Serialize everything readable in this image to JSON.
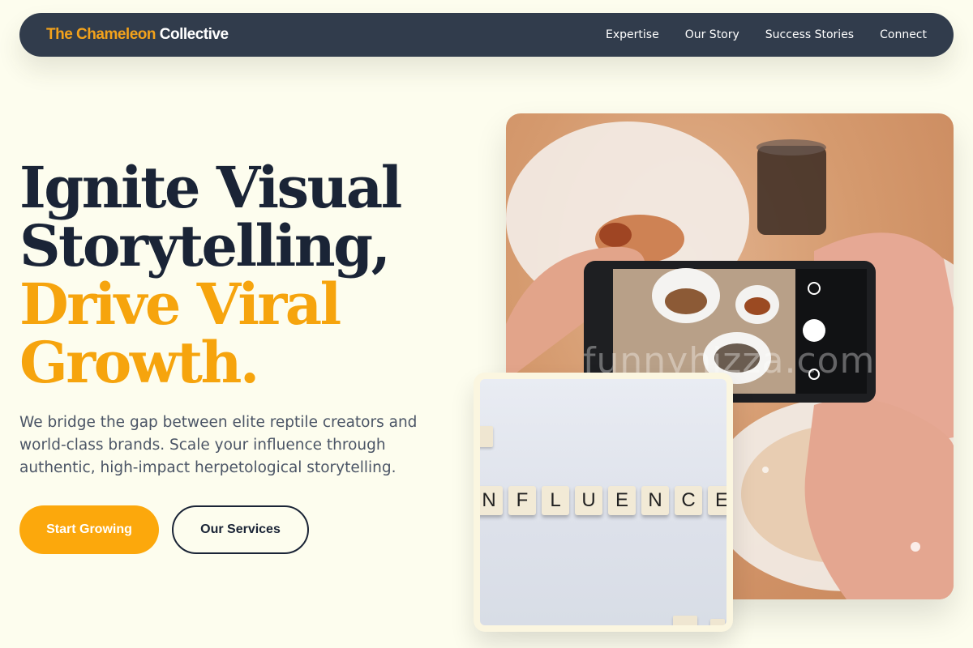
{
  "brand": {
    "accent": "The Chameleon",
    "rest": " Collective"
  },
  "nav": {
    "links": [
      "Expertise",
      "Our Story",
      "Success Stories",
      "Connect"
    ]
  },
  "hero": {
    "line1": "Ignite Visual",
    "line2": "Storytelling,",
    "line3": "Drive Viral",
    "line4": "Growth.",
    "lead": "We bridge the gap between elite reptile creators and world-class brands. Scale your influence through authentic, high-impact herpetological storytelling.",
    "primary_cta": "Start Growing",
    "secondary_cta": "Our Services"
  },
  "media": {
    "main_watermark": "funnyhizza.com",
    "card_word": "INFLUENCE",
    "card_tiles": [
      "N",
      "F",
      "L",
      "U",
      "E",
      "N",
      "C",
      "E"
    ]
  },
  "colors": {
    "background": "#fdfdee",
    "nav_bg": "#313c4c",
    "accent": "#f6a40d",
    "heading": "#1a2436",
    "body_text": "#4b5566"
  }
}
